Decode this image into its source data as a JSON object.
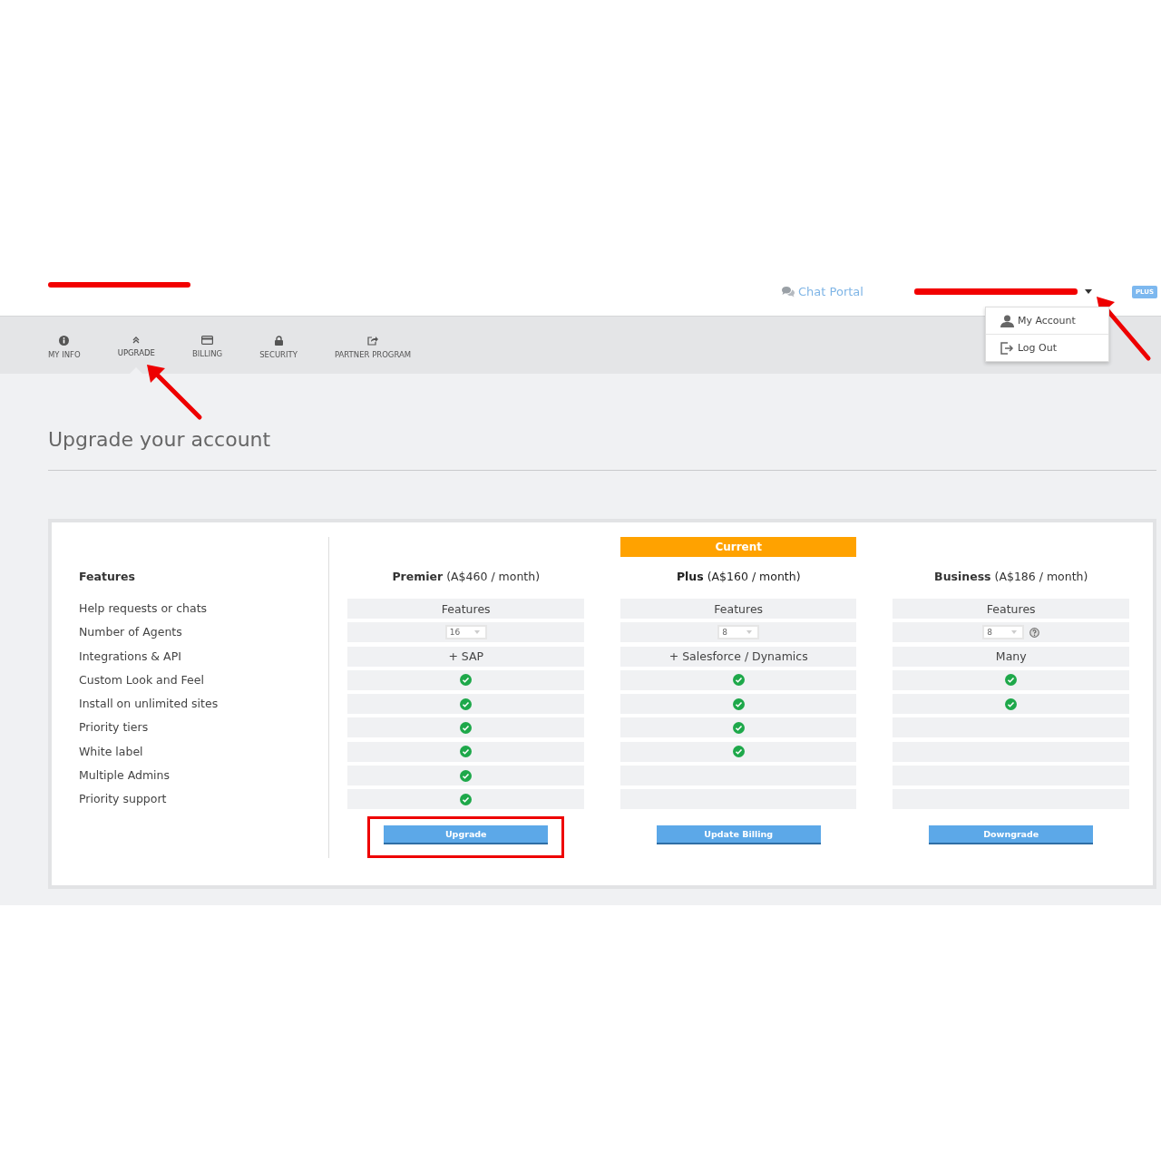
{
  "header": {
    "chat_portal": "Chat Portal",
    "plan_badge": "PLUS",
    "account_menu": {
      "expanded": true,
      "items": [
        {
          "label": "My Account",
          "kind": "account"
        },
        {
          "label": "Log Out",
          "kind": "logout"
        }
      ]
    }
  },
  "tabs": [
    {
      "label": "MY INFO",
      "kind": "info",
      "selected": false
    },
    {
      "label": "UPGRADE",
      "kind": "upgrade",
      "selected": true
    },
    {
      "label": "BILLING",
      "kind": "billing",
      "selected": false
    },
    {
      "label": "SECURITY",
      "kind": "security",
      "selected": false
    },
    {
      "label": "PARTNER PROGRAM",
      "kind": "partner",
      "selected": false
    }
  ],
  "page_title": "Upgrade your account",
  "features_heading": "Features",
  "features": [
    "Help requests or chats",
    "Number of Agents",
    "Integrations & API",
    "Custom Look and Feel",
    "Install on unlimited sites",
    "Priority tiers",
    "White label",
    "Multiple Admins",
    "Priority support"
  ],
  "plans": [
    {
      "name": "Premier",
      "price": "(A$460 / month)",
      "current": false,
      "button": "Upgrade",
      "highlighted": true,
      "cells": [
        {
          "kind": "text",
          "text": "Features"
        },
        {
          "kind": "select",
          "value": "16",
          "help": false
        },
        {
          "kind": "text",
          "text": "+ SAP"
        },
        {
          "kind": "check"
        },
        {
          "kind": "check"
        },
        {
          "kind": "check"
        },
        {
          "kind": "check"
        },
        {
          "kind": "check"
        },
        {
          "kind": "check"
        }
      ]
    },
    {
      "name": "Plus",
      "price": "(A$160 / month)",
      "current": true,
      "current_label": "Current",
      "button": "Update Billing",
      "highlighted": false,
      "cells": [
        {
          "kind": "text",
          "text": "Features"
        },
        {
          "kind": "select",
          "value": "8",
          "help": false
        },
        {
          "kind": "text",
          "text": "+ Salesforce / Dynamics"
        },
        {
          "kind": "check"
        },
        {
          "kind": "check"
        },
        {
          "kind": "check"
        },
        {
          "kind": "check"
        },
        {
          "kind": "empty"
        },
        {
          "kind": "empty"
        }
      ]
    },
    {
      "name": "Business",
      "price": "(A$186 / month)",
      "current": false,
      "button": "Downgrade",
      "highlighted": false,
      "cells": [
        {
          "kind": "text",
          "text": "Features"
        },
        {
          "kind": "select",
          "value": "8",
          "help": true
        },
        {
          "kind": "text",
          "text": "Many"
        },
        {
          "kind": "check"
        },
        {
          "kind": "check"
        },
        {
          "kind": "empty"
        },
        {
          "kind": "empty"
        },
        {
          "kind": "empty"
        },
        {
          "kind": "empty"
        }
      ]
    }
  ]
}
